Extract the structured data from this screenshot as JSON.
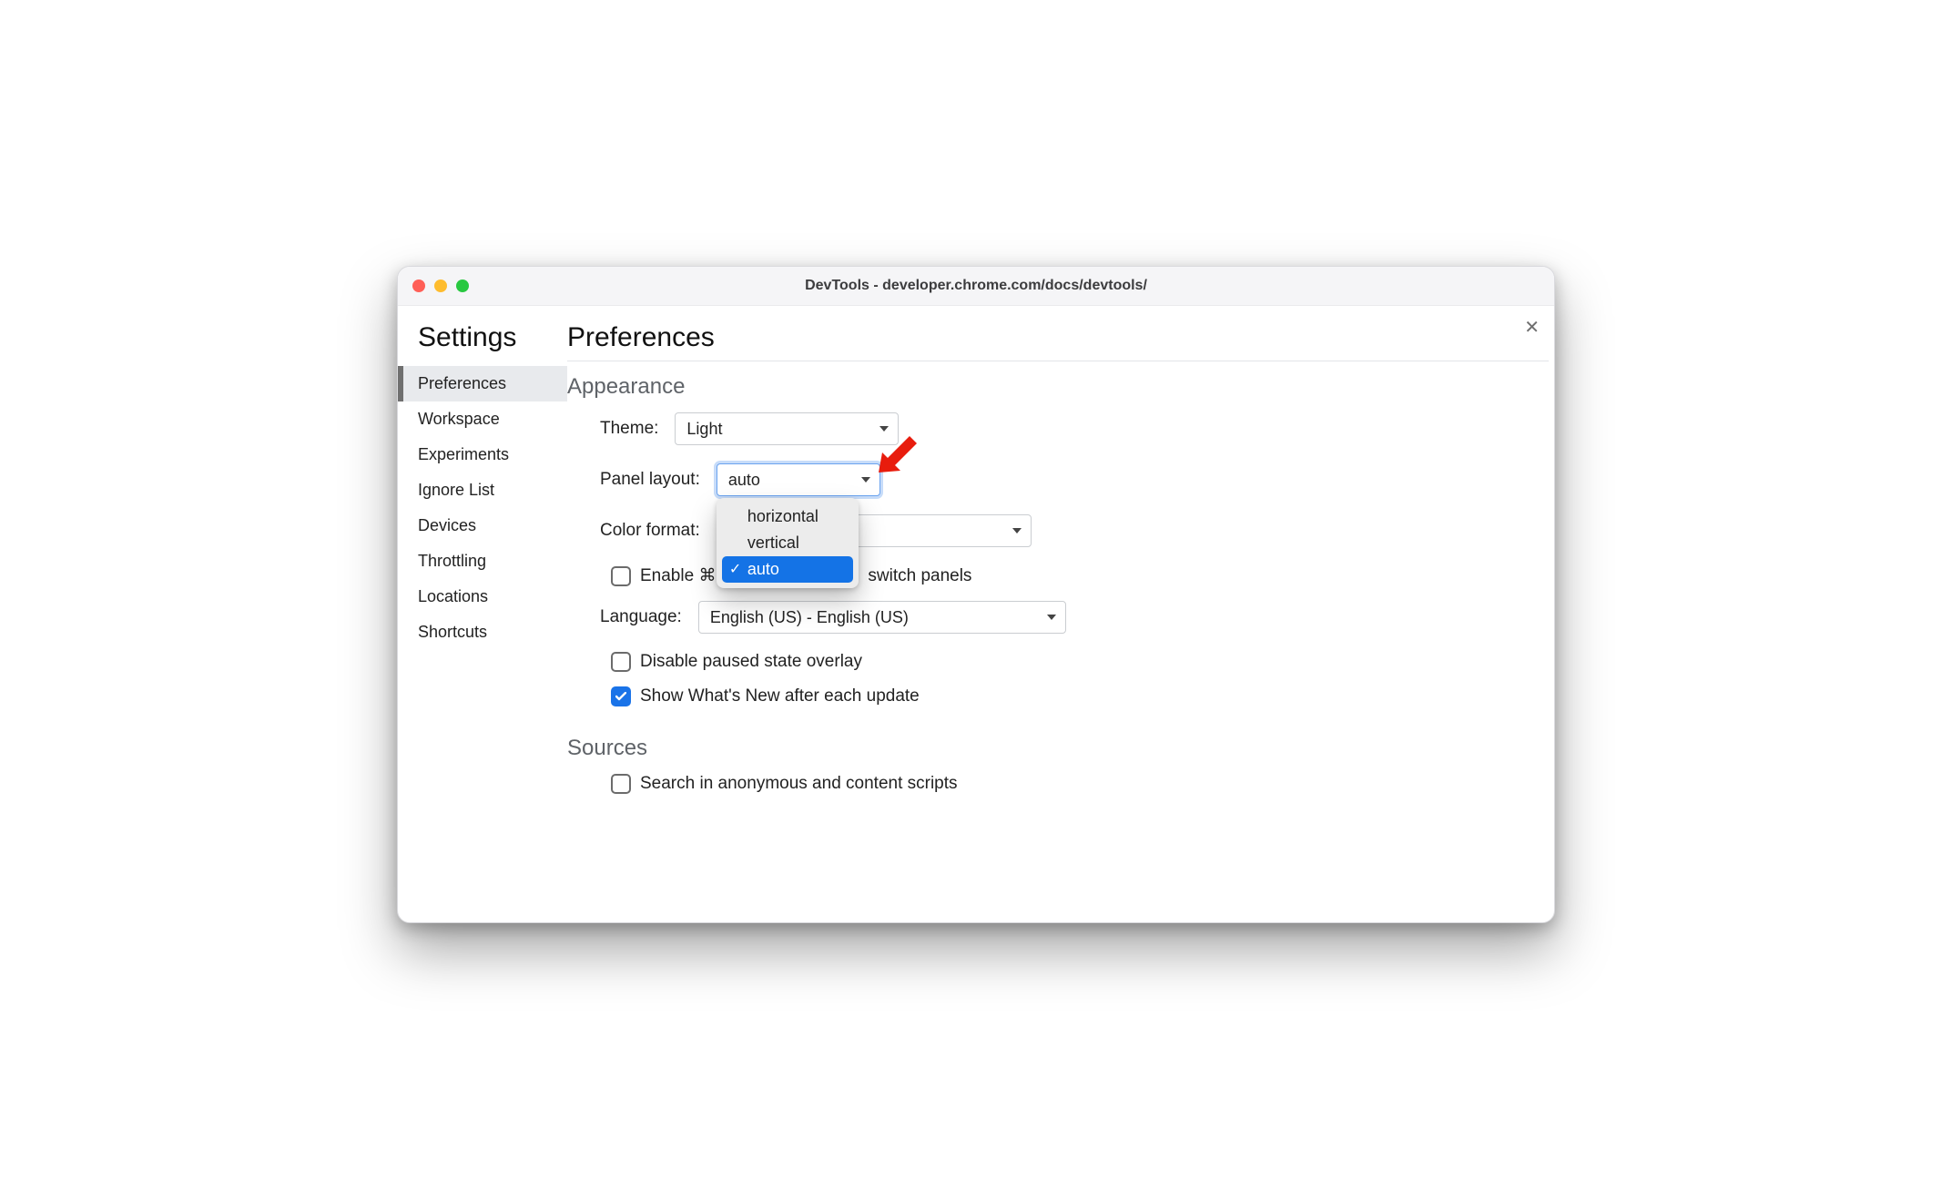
{
  "window": {
    "title": "DevTools - developer.chrome.com/docs/devtools/"
  },
  "settings_heading": "Settings",
  "sidebar": {
    "items": [
      {
        "label": "Preferences",
        "active": true
      },
      {
        "label": "Workspace"
      },
      {
        "label": "Experiments"
      },
      {
        "label": "Ignore List"
      },
      {
        "label": "Devices"
      },
      {
        "label": "Throttling"
      },
      {
        "label": "Locations"
      },
      {
        "label": "Shortcuts"
      }
    ]
  },
  "page_title": "Preferences",
  "groups": {
    "appearance": {
      "title": "Appearance",
      "theme": {
        "label": "Theme:",
        "selected": "Light"
      },
      "panel_layout": {
        "label": "Panel layout:",
        "selected": "auto",
        "options": [
          "horizontal",
          "vertical",
          "auto"
        ],
        "selected_index": 2
      },
      "color_format": {
        "label": "Color format:",
        "selected": ""
      },
      "enable_shortcut": {
        "checked": false,
        "label_pre": "Enable ⌘ + ",
        "label_post": " switch panels"
      },
      "language": {
        "label": "Language:",
        "selected": "English (US) - English (US)"
      },
      "disable_overlay": {
        "checked": false,
        "label": "Disable paused state overlay"
      },
      "show_whats_new": {
        "checked": true,
        "label": "Show What's New after each update"
      }
    },
    "sources": {
      "title": "Sources",
      "search_anon": {
        "checked": false,
        "label": "Search in anonymous and content scripts"
      }
    }
  },
  "annotation": {
    "arrow_color": "#e81c0d"
  }
}
